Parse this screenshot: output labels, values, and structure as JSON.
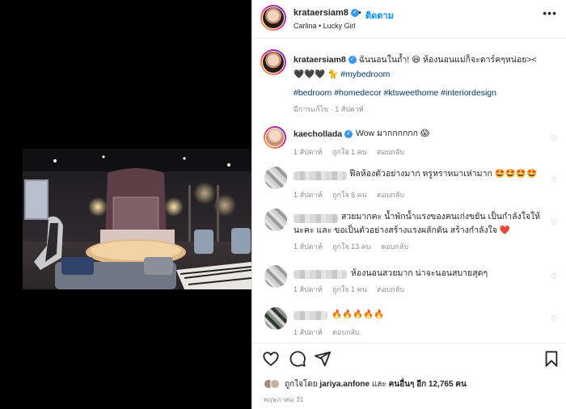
{
  "post": {
    "username": "krataersiam8",
    "follow_label": "ติดตาม",
    "subtitle": "Carlina • Lucky Girl",
    "more_label": "•••"
  },
  "caption": {
    "username": "krataersiam8",
    "text_line1": "ฉันนอนในถ้ำ! 😆 ห้องนอนแม่ก็จะดาร์คๆหน่อย><",
    "text_line2": "🖤🖤🖤 🐈",
    "line2_tag": "#mybedroom",
    "hashtags": "#bedroom #homedecor #ktsweethome #interiordesign",
    "edited": "มีการแก้ไข · 1 สัปดาห์"
  },
  "comments": [
    {
      "name": "kaechollada",
      "text": "Wow มากกกกกก 😱",
      "meta": [
        "1 สัปดาห์",
        "ถูกใจ 1 คน",
        "ตอบกลับ"
      ]
    },
    {
      "name": "",
      "text": "ฟีลห้องตัวอย่างมาก หรูหราหมาเห่ามาก 🤩🤩🤩🤩",
      "meta": [
        "1 สัปดาห์",
        "ถูกใจ 6 คน",
        "ตอบกลับ"
      ]
    },
    {
      "name": "",
      "text_line1": "สวยมากคะ น้ำพักน้ำแรงของคนเก่งขยัน เป็นกำลังใจให้",
      "text_line2": "นะคะ และ ขอเป็นตัวอย่างสร้างแรงผลักดัน สร้างกำลังใจ ❤️",
      "meta": [
        "1 สัปดาห์",
        "ถูกใจ 13 คน",
        "ตอบกลับ"
      ]
    },
    {
      "name": "",
      "text": "ห้องนอนสวยมาก น่าจะนอนสบายสุดๆ",
      "meta": [
        "1 สัปดาห์",
        "ถูกใจ 1 คน",
        "ตอบกลับ"
      ]
    },
    {
      "name": "",
      "text": "🔥🔥🔥🔥🔥",
      "meta": [
        "1 สัปดาห์",
        "ตอบกลับ"
      ]
    }
  ],
  "likes": {
    "prefix": "ถูกใจโดย",
    "user": "jariya.anfone",
    "middle": "และ",
    "others": "คนอื่นๆ อีก 12,765 คน"
  },
  "date": "พฤษภาคม 31",
  "icons": {
    "like": "heart-icon",
    "comment": "comment-icon",
    "share": "share-icon",
    "save": "bookmark-icon",
    "verified": "verified-badge-icon"
  },
  "colors": {
    "link": "#0095f6",
    "hashtag": "#00376b",
    "muted": "#8e8e8e"
  }
}
